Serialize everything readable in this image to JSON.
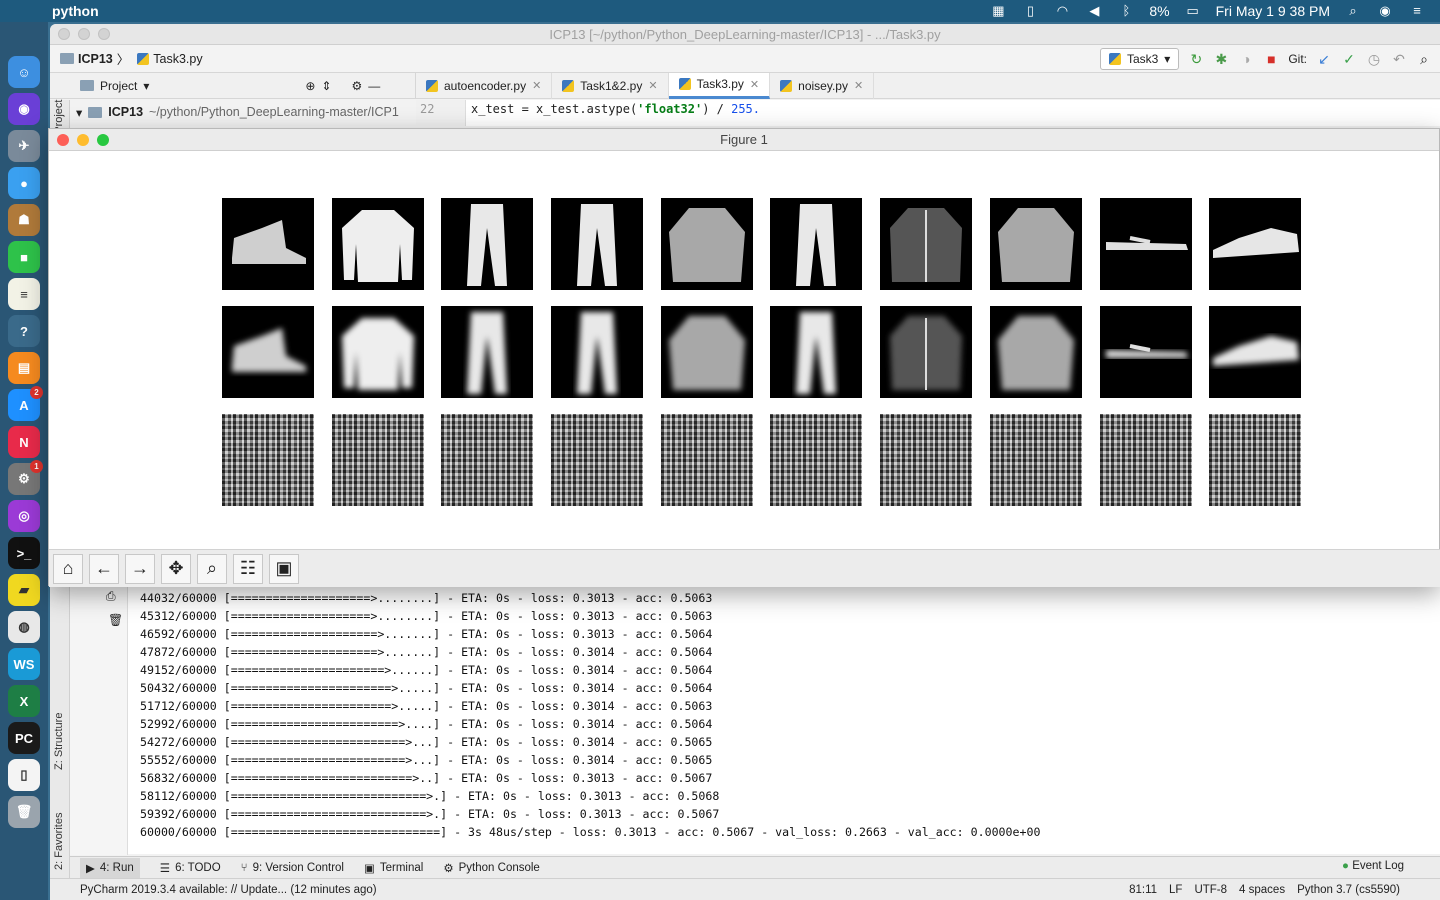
{
  "menubar": {
    "app_name": "python",
    "battery": "8%",
    "datetime": "Fri May 1  9 38 PM"
  },
  "dock": {
    "apps": [
      {
        "name": "finder",
        "glyph": "☺",
        "color": "#3d8fe0"
      },
      {
        "name": "siri",
        "glyph": "◉",
        "color": "#6a3fd6"
      },
      {
        "name": "launchpad",
        "glyph": "✈",
        "color": "#7a8a9a"
      },
      {
        "name": "messages",
        "glyph": "●",
        "color": "#3aa0f0"
      },
      {
        "name": "contacts",
        "glyph": "☗",
        "color": "#b07a3a"
      },
      {
        "name": "facetime",
        "glyph": "■",
        "color": "#2ec24a"
      },
      {
        "name": "notes",
        "glyph": "≡",
        "color": "#f2f2e6"
      },
      {
        "name": "help",
        "glyph": "?",
        "color": "#3a6a8a"
      },
      {
        "name": "books",
        "glyph": "▤",
        "color": "#f58a1f"
      },
      {
        "name": "app-store",
        "glyph": "A",
        "color": "#1e90ff",
        "badge": "2"
      },
      {
        "name": "news",
        "glyph": "N",
        "color": "#e82a4a"
      },
      {
        "name": "system-preferences",
        "glyph": "⚙",
        "color": "#777",
        "badge": "1"
      },
      {
        "name": "podcasts",
        "glyph": "◎",
        "color": "#9b3ad6"
      },
      {
        "name": "terminal",
        "glyph": ">_",
        "color": "#111"
      },
      {
        "name": "stickies",
        "glyph": "▰",
        "color": "#f0d820"
      },
      {
        "name": "chrome",
        "glyph": "◍",
        "color": "#e8e8e8"
      },
      {
        "name": "webstorm",
        "glyph": "WS",
        "color": "#1a9ad6"
      },
      {
        "name": "excel",
        "glyph": "X",
        "color": "#1e7e45"
      },
      {
        "name": "pycharm",
        "glyph": "PC",
        "color": "#1a1a1a"
      },
      {
        "name": "document",
        "glyph": "▯",
        "color": "#f4f4f4"
      },
      {
        "name": "trash",
        "glyph": "🗑",
        "color": "#9aa4ad"
      }
    ]
  },
  "ide": {
    "title": "ICP13 [~/python/Python_DeepLearning-master/ICP13] - .../Task3.py",
    "breadcrumb": [
      "ICP13",
      "Task3.py"
    ],
    "run_config": "Task3",
    "git_label": "Git:",
    "project_label": "Project",
    "tabs": [
      {
        "label": "autoencoder.py",
        "active": false
      },
      {
        "label": "Task1&2.py",
        "active": false
      },
      {
        "label": "Task3.py",
        "active": true
      },
      {
        "label": "noisey.py",
        "active": false
      }
    ],
    "project_root": "ICP13",
    "project_path": "~/python/Python_DeepLearning-master/ICP1",
    "line_number": "22",
    "code_pre": "x_test = x_test.astype(",
    "code_str": "'float32'",
    "code_post": ") / ",
    "code_num": "255.",
    "side_labels": {
      "project": "1: Project",
      "structure": "Z: Structure",
      "favorites": "2: Favorites"
    }
  },
  "console_lines": [
    "44032/60000 [====================>........] - ETA: 0s - loss: 0.3013 - acc: 0.5063",
    "45312/60000 [====================>........] - ETA: 0s - loss: 0.3013 - acc: 0.5063",
    "46592/60000 [=====================>.......] - ETA: 0s - loss: 0.3013 - acc: 0.5064",
    "47872/60000 [=====================>.......] - ETA: 0s - loss: 0.3014 - acc: 0.5064",
    "49152/60000 [======================>......] - ETA: 0s - loss: 0.3014 - acc: 0.5064",
    "50432/60000 [=======================>.....] - ETA: 0s - loss: 0.3014 - acc: 0.5064",
    "51712/60000 [=======================>.....] - ETA: 0s - loss: 0.3014 - acc: 0.5063",
    "52992/60000 [========================>....] - ETA: 0s - loss: 0.3014 - acc: 0.5064",
    "54272/60000 [=========================>...] - ETA: 0s - loss: 0.3014 - acc: 0.5065",
    "55552/60000 [=========================>...] - ETA: 0s - loss: 0.3014 - acc: 0.5065",
    "56832/60000 [==========================>..] - ETA: 0s - loss: 0.3013 - acc: 0.5067",
    "58112/60000 [============================>.] - ETA: 0s - loss: 0.3013 - acc: 0.5068",
    "59392/60000 [============================>.] - ETA: 0s - loss: 0.3013 - acc: 0.5067",
    "60000/60000 [==============================] - 3s 48us/step - loss: 0.3013 - acc: 0.5067 - val_loss: 0.2663 - val_acc: 0.0000e+00"
  ],
  "bottom_tabs": [
    {
      "label": "4: Run",
      "icon": "▶",
      "active": true
    },
    {
      "label": "6: TODO",
      "icon": "☰",
      "active": false
    },
    {
      "label": "9: Version Control",
      "icon": "⑂",
      "active": false
    },
    {
      "label": "Terminal",
      "icon": "▣",
      "active": false
    },
    {
      "label": "Python Console",
      "icon": "⚙",
      "active": false
    }
  ],
  "event_log": "Event Log",
  "status": {
    "message": "PyCharm 2019.3.4 available: // Update... (12 minutes ago)",
    "position": "81:11",
    "line_sep": "LF",
    "encoding": "UTF-8",
    "indent": "4 spaces",
    "interpreter": "Python 3.7 (cs5590)"
  },
  "figure": {
    "title": "Figure 1",
    "rows": [
      {
        "kind": "original",
        "items": [
          "ankle-boot",
          "pullover",
          "trouser",
          "trouser",
          "shirt",
          "trouser",
          "coat",
          "shirt",
          "sandal",
          "sneaker"
        ]
      },
      {
        "kind": "reconstructed",
        "items": [
          "ankle-boot",
          "pullover",
          "trouser",
          "trouser",
          "shirt",
          "trouser",
          "coat",
          "shirt",
          "sandal",
          "sneaker"
        ]
      },
      {
        "kind": "noisy",
        "items": [
          "noise",
          "noise",
          "noise",
          "noise",
          "noise",
          "noise",
          "noise",
          "noise",
          "noise",
          "noise"
        ]
      }
    ],
    "toolbar": [
      "home-icon",
      "back-icon",
      "forward-icon",
      "pan-icon",
      "zoom-icon",
      "configure-icon",
      "save-icon"
    ]
  }
}
